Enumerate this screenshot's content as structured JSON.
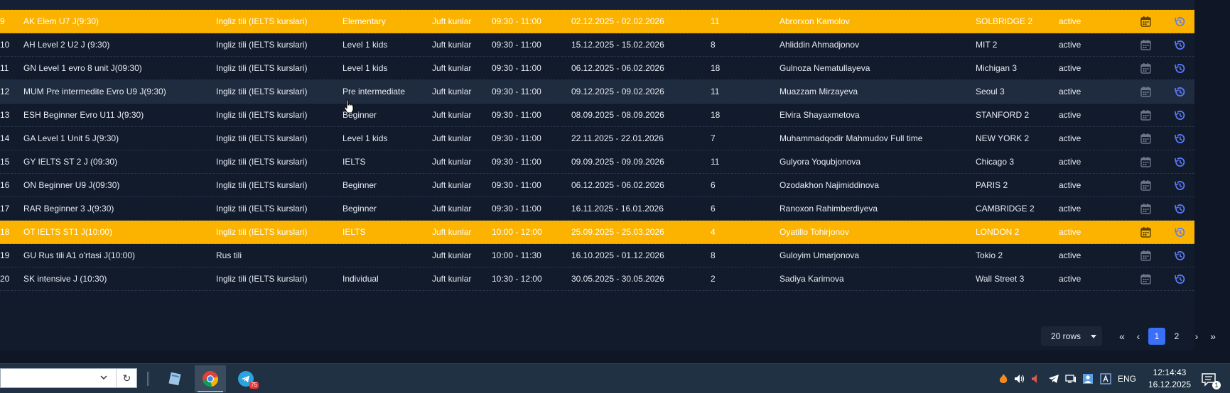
{
  "table": {
    "rows": [
      {
        "no": "9",
        "name": "AK Elem U7 J(9:30)",
        "subject": "Ingliz tili (IELTS kurslari)",
        "level": "Elementary",
        "days": "Juft kunlar",
        "time": "09:30 - 11:00",
        "dates": "02.12.2025 - 02.02.2026",
        "students": "11",
        "teacher": "Abrorxon Kamolov",
        "room": "SOLBRIDGE 2",
        "status": "active",
        "state": "highlight"
      },
      {
        "no": "10",
        "name": "AH Level 2 U2 J (9:30)",
        "subject": "Ingliz tili (IELTS kurslari)",
        "level": "Level 1 kids",
        "days": "Juft kunlar",
        "time": "09:30 - 11:00",
        "dates": "15.12.2025 - 15.02.2026",
        "students": "8",
        "teacher": "Ahliddin Ahmadjonov",
        "room": "MIT 2",
        "status": "active",
        "state": "normal"
      },
      {
        "no": "11",
        "name": "GN Level 1 evro 8 unit J(09:30)",
        "subject": "Ingliz tili (IELTS kurslari)",
        "level": "Level 1 kids",
        "days": "Juft kunlar",
        "time": "09:30 - 11:00",
        "dates": "06.12.2025 - 06.02.2026",
        "students": "18",
        "teacher": "Gulnoza Nematullayeva",
        "room": "Michigan 3",
        "status": "active",
        "state": "normal"
      },
      {
        "no": "12",
        "name": "MUM Pre intermedite Evro U9 J(9:30)",
        "subject": "Ingliz tili (IELTS kurslari)",
        "level": "Pre intermediate",
        "days": "Juft kunlar",
        "time": "09:30 - 11:00",
        "dates": "09.12.2025 - 09.02.2026",
        "students": "11",
        "teacher": "Muazzam Mirzayeva",
        "room": "Seoul 3",
        "status": "active",
        "state": "hover"
      },
      {
        "no": "13",
        "name": "ESH Beginner Evro U11 J(9:30)",
        "subject": "Ingliz tili (IELTS kurslari)",
        "level": "Beginner",
        "days": "Juft kunlar",
        "time": "09:30 - 11:00",
        "dates": "08.09.2025 - 08.09.2026",
        "students": "18",
        "teacher": "Elvira Shayaxmetova",
        "room": "STANFORD 2",
        "status": "active",
        "state": "normal"
      },
      {
        "no": "14",
        "name": "GA Level 1 Unit 5 J(9:30)",
        "subject": "Ingliz tili (IELTS kurslari)",
        "level": "Level 1 kids",
        "days": "Juft kunlar",
        "time": "09:30 - 11:00",
        "dates": "22.11.2025 - 22.01.2026",
        "students": "7",
        "teacher": "Muhammadqodir Mahmudov Full time",
        "room": "NEW YORK 2",
        "status": "active",
        "state": "normal"
      },
      {
        "no": "15",
        "name": "GY IELTS ST 2 J (09:30)",
        "subject": "Ingliz tili (IELTS kurslari)",
        "level": "IELTS",
        "days": "Juft kunlar",
        "time": "09:30 - 11:00",
        "dates": "09.09.2025 - 09.09.2026",
        "students": "11",
        "teacher": "Gulyora Yoqubjonova",
        "room": "Chicago 3",
        "status": "active",
        "state": "normal"
      },
      {
        "no": "16",
        "name": "ON Beginner U9 J(09:30)",
        "subject": "Ingliz tili (IELTS kurslari)",
        "level": "Beginner",
        "days": "Juft kunlar",
        "time": "09:30 - 11:00",
        "dates": "06.12.2025 - 06.02.2026",
        "students": "6",
        "teacher": "Ozodakhon Najimiddinova",
        "room": "PARIS 2",
        "status": "active",
        "state": "normal"
      },
      {
        "no": "17",
        "name": "RAR Beginner 3 J(9:30)",
        "subject": "Ingliz tili (IELTS kurslari)",
        "level": "Beginner",
        "days": "Juft kunlar",
        "time": "09:30 - 11:00",
        "dates": "16.11.2025 - 16.01.2026",
        "students": "6",
        "teacher": "Ranoxon Rahimberdiyeva",
        "room": "CAMBRIDGE 2",
        "status": "active",
        "state": "normal"
      },
      {
        "no": "18",
        "name": "OT IELTS ST1 J(10:00)",
        "subject": "Ingliz tili (IELTS kurslari)",
        "level": "IELTS",
        "days": "Juft kunlar",
        "time": "10:00 - 12:00",
        "dates": "25.09.2025 - 25.03.2026",
        "students": "4",
        "teacher": "Oyatillo Tohirjonov",
        "room": "LONDON 2",
        "status": "active",
        "state": "highlight"
      },
      {
        "no": "19",
        "name": "GU Rus tili A1 o'rtasi J(10:00)",
        "subject": "Rus tili",
        "level": "",
        "days": "Juft kunlar",
        "time": "10:00 - 11:30",
        "dates": "16.10.2025 - 01.12.2026",
        "students": "8",
        "teacher": "Guloyim Umarjonova",
        "room": "Tokio 2",
        "status": "active",
        "state": "normal"
      },
      {
        "no": "20",
        "name": "SK intensive J (10:30)",
        "subject": "Ingliz tili (IELTS kurslari)",
        "level": "Individual",
        "days": "Juft kunlar",
        "time": "10:30 - 12:00",
        "dates": "30.05.2025 - 30.05.2026",
        "students": "2",
        "teacher": "Sadiya Karimova",
        "room": "Wall Street 3",
        "status": "active",
        "state": "normal"
      }
    ]
  },
  "pagination": {
    "rows_label": "20 rows",
    "first": "«",
    "prev": "‹",
    "pages": [
      "1",
      "2"
    ],
    "current": "1",
    "next": "›",
    "last": "»"
  },
  "taskbar": {
    "search_value": "",
    "refresh_glyph": "↻",
    "telegram_badge": "75",
    "language": "ENG",
    "time": "12:14:43",
    "date": "16.12.2025",
    "notification_count": "1"
  },
  "colors": {
    "highlight_row": "#fbb300",
    "accent_blue": "#3a6ff7",
    "history_icon": "#5b7cff",
    "panel_bg": "#121b2b"
  }
}
